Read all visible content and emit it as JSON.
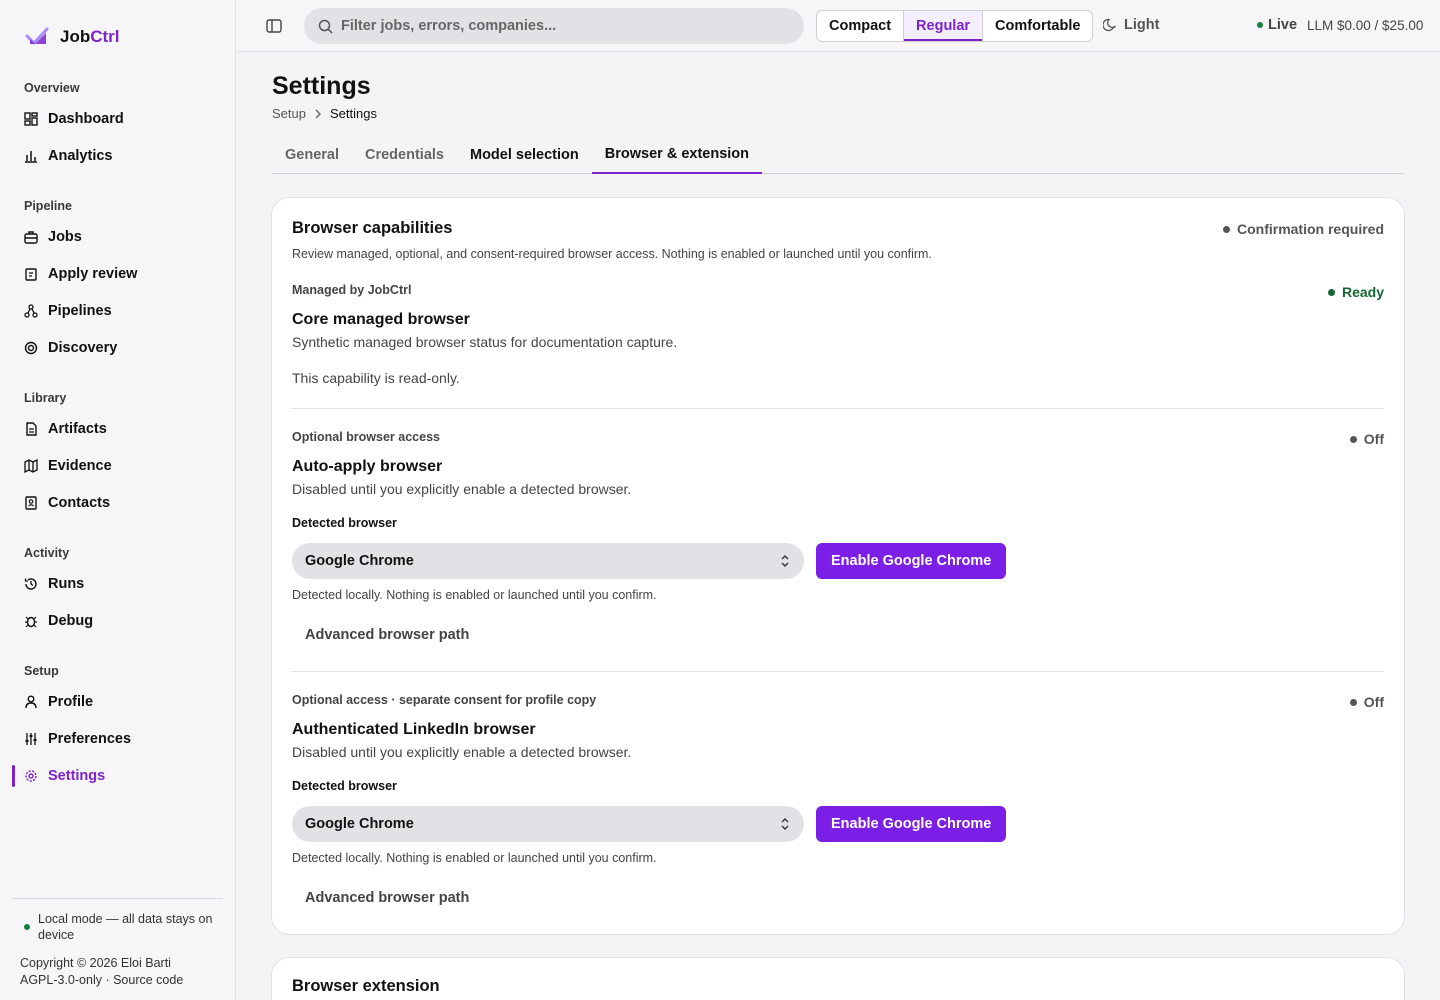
{
  "app": {
    "brand_prefix": "Job",
    "brand_accent": "Ctrl",
    "accent_color": "#7e22ce"
  },
  "sidebar": {
    "groups": [
      {
        "label": "Overview",
        "items": [
          {
            "label": "Dashboard",
            "icon": "dashboard-icon"
          },
          {
            "label": "Analytics",
            "icon": "analytics-icon"
          }
        ]
      },
      {
        "label": "Pipeline",
        "items": [
          {
            "label": "Jobs",
            "icon": "briefcase-icon"
          },
          {
            "label": "Apply review",
            "icon": "clipboard-icon"
          },
          {
            "label": "Pipelines",
            "icon": "pipelines-icon"
          },
          {
            "label": "Discovery",
            "icon": "discovery-icon"
          }
        ]
      },
      {
        "label": "Library",
        "items": [
          {
            "label": "Artifacts",
            "icon": "document-icon"
          },
          {
            "label": "Evidence",
            "icon": "map-icon"
          },
          {
            "label": "Contacts",
            "icon": "contacts-icon"
          }
        ]
      },
      {
        "label": "Activity",
        "items": [
          {
            "label": "Runs",
            "icon": "history-icon"
          },
          {
            "label": "Debug",
            "icon": "bug-icon"
          }
        ]
      },
      {
        "label": "Setup",
        "items": [
          {
            "label": "Profile",
            "icon": "user-icon"
          },
          {
            "label": "Preferences",
            "icon": "sliders-icon"
          },
          {
            "label": "Settings",
            "icon": "gear-icon",
            "active": true
          }
        ]
      }
    ],
    "footer": {
      "local_mode": "Local mode — all data stays on device",
      "copyright": "Copyright © 2026 Eloi Barti",
      "license": "AGPL-3.0-only · Source code"
    }
  },
  "topbar": {
    "search_placeholder": "Filter jobs, errors, companies...",
    "density": [
      "Compact",
      "Regular",
      "Comfortable"
    ],
    "density_selected": "Regular",
    "theme_label": "Light",
    "live_label": "Live",
    "llm_usage": "LLM $0.00 / $25.00"
  },
  "page": {
    "title": "Settings",
    "breadcrumb": [
      "Setup",
      "Settings"
    ],
    "tabs": [
      "General",
      "Credentials",
      "Model selection",
      "Browser & extension"
    ],
    "active_tab": "Browser & extension"
  },
  "capabilities": {
    "title": "Browser capabilities",
    "subtitle": "Review managed, optional, and consent-required browser access. Nothing is enabled or launched until you confirm.",
    "status": "Confirmation required",
    "core": {
      "kicker": "Managed by JobCtrl",
      "title": "Core managed browser",
      "desc": "Synthetic managed browser status for documentation capture.",
      "note": "This capability is read-only.",
      "status": "Ready"
    },
    "auto_apply": {
      "kicker": "Optional browser access",
      "title": "Auto-apply browser",
      "desc": "Disabled until you explicitly enable a detected browser.",
      "status": "Off",
      "detected_label": "Detected browser",
      "selected_browser": "Google Chrome",
      "enable_button": "Enable Google Chrome",
      "hint": "Detected locally. Nothing is enabled or launched until you confirm.",
      "advanced": "Advanced browser path"
    },
    "linkedin": {
      "kicker": "Optional access · separate consent for profile copy",
      "title": "Authenticated LinkedIn browser",
      "desc": "Disabled until you explicitly enable a detected browser.",
      "status": "Off",
      "detected_label": "Detected browser",
      "selected_browser": "Google Chrome",
      "enable_button": "Enable Google Chrome",
      "hint": "Detected locally. Nothing is enabled or launched until you confirm.",
      "advanced": "Advanced browser path"
    }
  },
  "extension": {
    "title": "Browser extension"
  }
}
